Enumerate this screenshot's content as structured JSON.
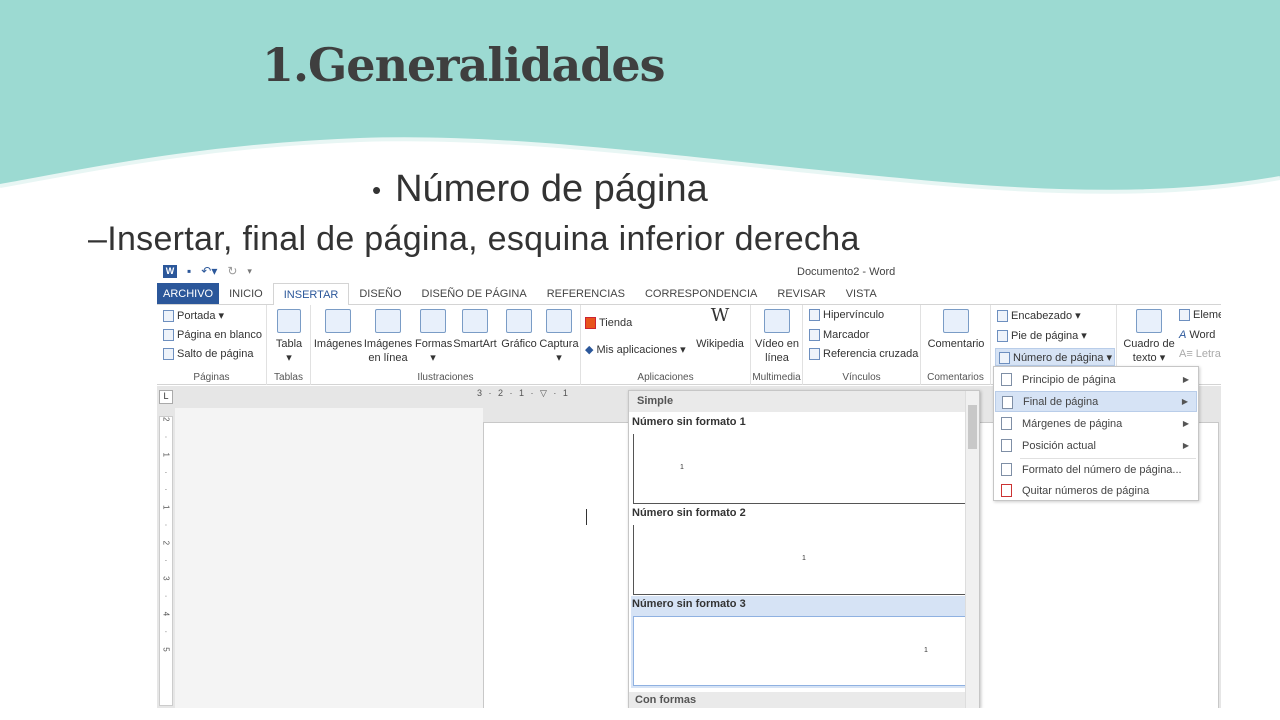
{
  "slide": {
    "title": "1.Generalidades",
    "bullet1": "Número de página",
    "bullet2": "–Insertar, final de página, esquina inferior derecha"
  },
  "word": {
    "doc_title": "Documento2 - Word",
    "tabs": [
      "ARCHIVO",
      "INICIO",
      "INSERTAR",
      "DISEÑO",
      "DISEÑO DE PÁGINA",
      "REFERENCIAS",
      "CORRESPONDENCIA",
      "REVISAR",
      "VISTA"
    ],
    "pages_group": {
      "items": [
        "Portada",
        "Página en blanco",
        "Salto de página"
      ],
      "label": "Páginas"
    },
    "tables_group": {
      "button": "Tabla",
      "label": "Tablas"
    },
    "illus_group": {
      "buttons": [
        "Imágenes",
        "Imágenes en línea",
        "Formas",
        "SmartArt",
        "Gráfico",
        "Captura"
      ],
      "label": "Ilustraciones"
    },
    "apps_group": {
      "tienda": "Tienda",
      "mis_apps": "Mis aplicaciones",
      "wikipedia": "Wikipedia",
      "label": "Aplicaciones"
    },
    "media_group": {
      "button": "Vídeo en línea",
      "label": "Multimedia"
    },
    "links_group": {
      "items": [
        "Hipervínculo",
        "Marcador",
        "Referencia cruzada"
      ],
      "label": "Vínculos"
    },
    "comments_group": {
      "button": "Comentario",
      "label": "Comentarios"
    },
    "header_group": {
      "items": [
        "Encabezado",
        "Pie de página",
        "Número de página"
      ]
    },
    "text_group": {
      "button": "Cuadro de texto",
      "items": [
        "Eleme",
        "Word",
        "Letra"
      ]
    },
    "ruler_text": "3 · 2 · 1 · ▽ · 1",
    "vruler_text": "2 · 1 · · 1 · 2 · 3 · 4 · 5",
    "gallery": {
      "header": "Simple",
      "items": [
        "Número sin formato 1",
        "Número sin formato 2",
        "Número sin formato 3"
      ],
      "footer": "Con formas",
      "page_num": "1"
    },
    "submenu": {
      "items": [
        "Principio de página",
        "Final de página",
        "Márgenes de página",
        "Posición actual",
        "Formato del número de página...",
        "Quitar números de página"
      ]
    }
  }
}
